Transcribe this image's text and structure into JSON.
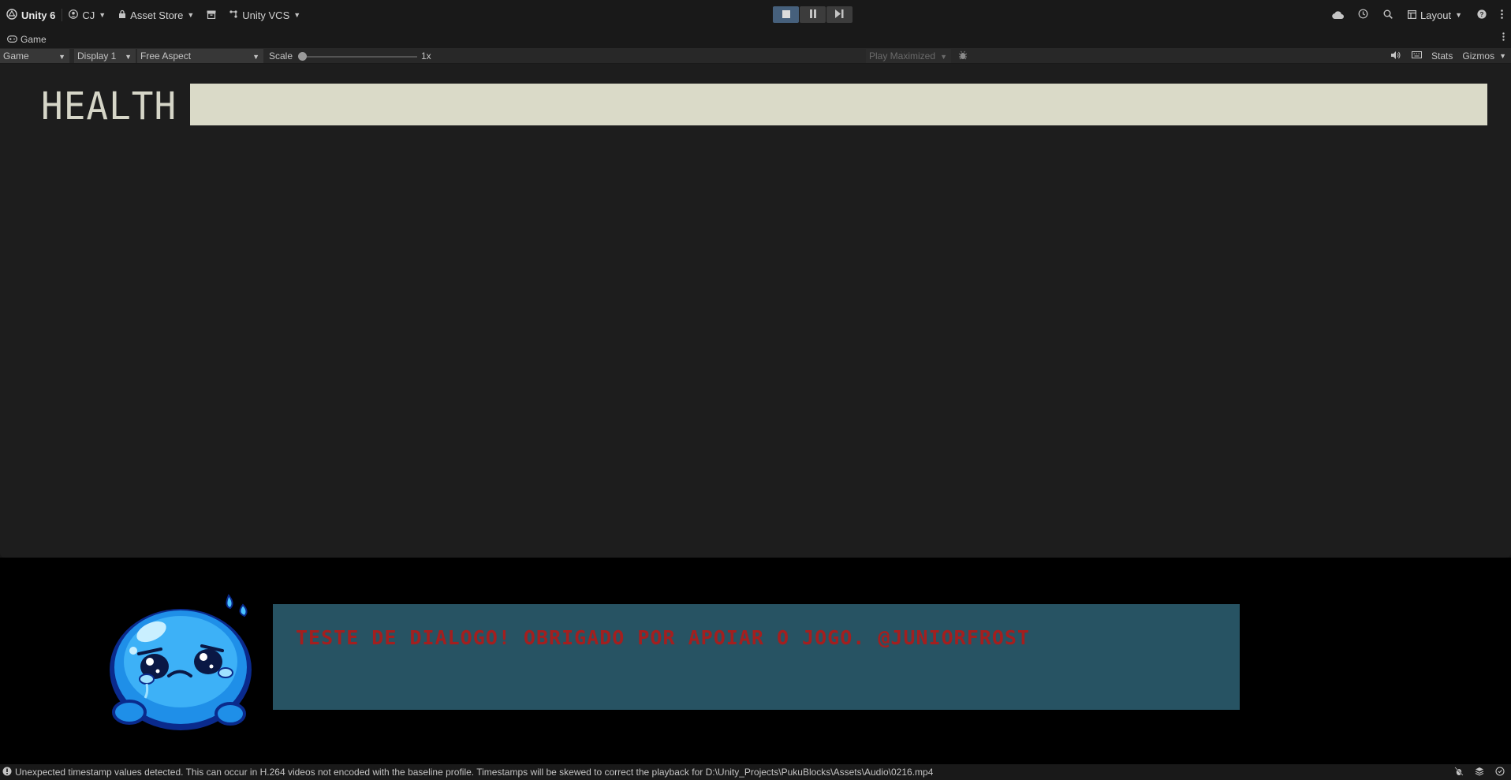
{
  "topbar": {
    "app": "Unity 6",
    "account": "CJ",
    "asset_store": "Asset Store",
    "vcs": "Unity VCS",
    "layout": "Layout"
  },
  "tab": {
    "label": "Game"
  },
  "game_toolbar": {
    "view_mode": "Game",
    "display": "Display 1",
    "aspect": "Free Aspect",
    "scale_label": "Scale",
    "scale_value": "1x",
    "play_mode": "Play Maximized",
    "stats": "Stats",
    "gizmos": "Gizmos"
  },
  "game": {
    "health_label": "HEALTH",
    "health_fraction": 1.0,
    "dialog_text": "TESTE DE DIALOGO! OBRIGADO POR APOIAR O JOGO. @JUNIORFROST"
  },
  "status": {
    "message": "Unexpected timestamp values detected. This can occur in H.264 videos not encoded with the baseline profile. Timestamps will be skewed to correct the playback for D:\\Unity_Projects\\PukuBlocks\\Assets\\Audio\\0216.mp4"
  },
  "colors": {
    "health_fill": "#dadac8",
    "dialog_bg": "#275363",
    "dialog_text": "#a31f1f",
    "play_active": "#46607c"
  },
  "icons": [
    "unity-logo-icon",
    "account-icon",
    "lock-icon",
    "package-icon",
    "vcs-branch-icon",
    "stop-icon",
    "pause-icon",
    "step-icon",
    "cloud-icon",
    "history-icon",
    "search-icon",
    "layout-icon",
    "help-icon",
    "more-icon",
    "gamepad-icon",
    "audio-icon",
    "keyboard-icon",
    "bug-icon",
    "warning-icon"
  ]
}
